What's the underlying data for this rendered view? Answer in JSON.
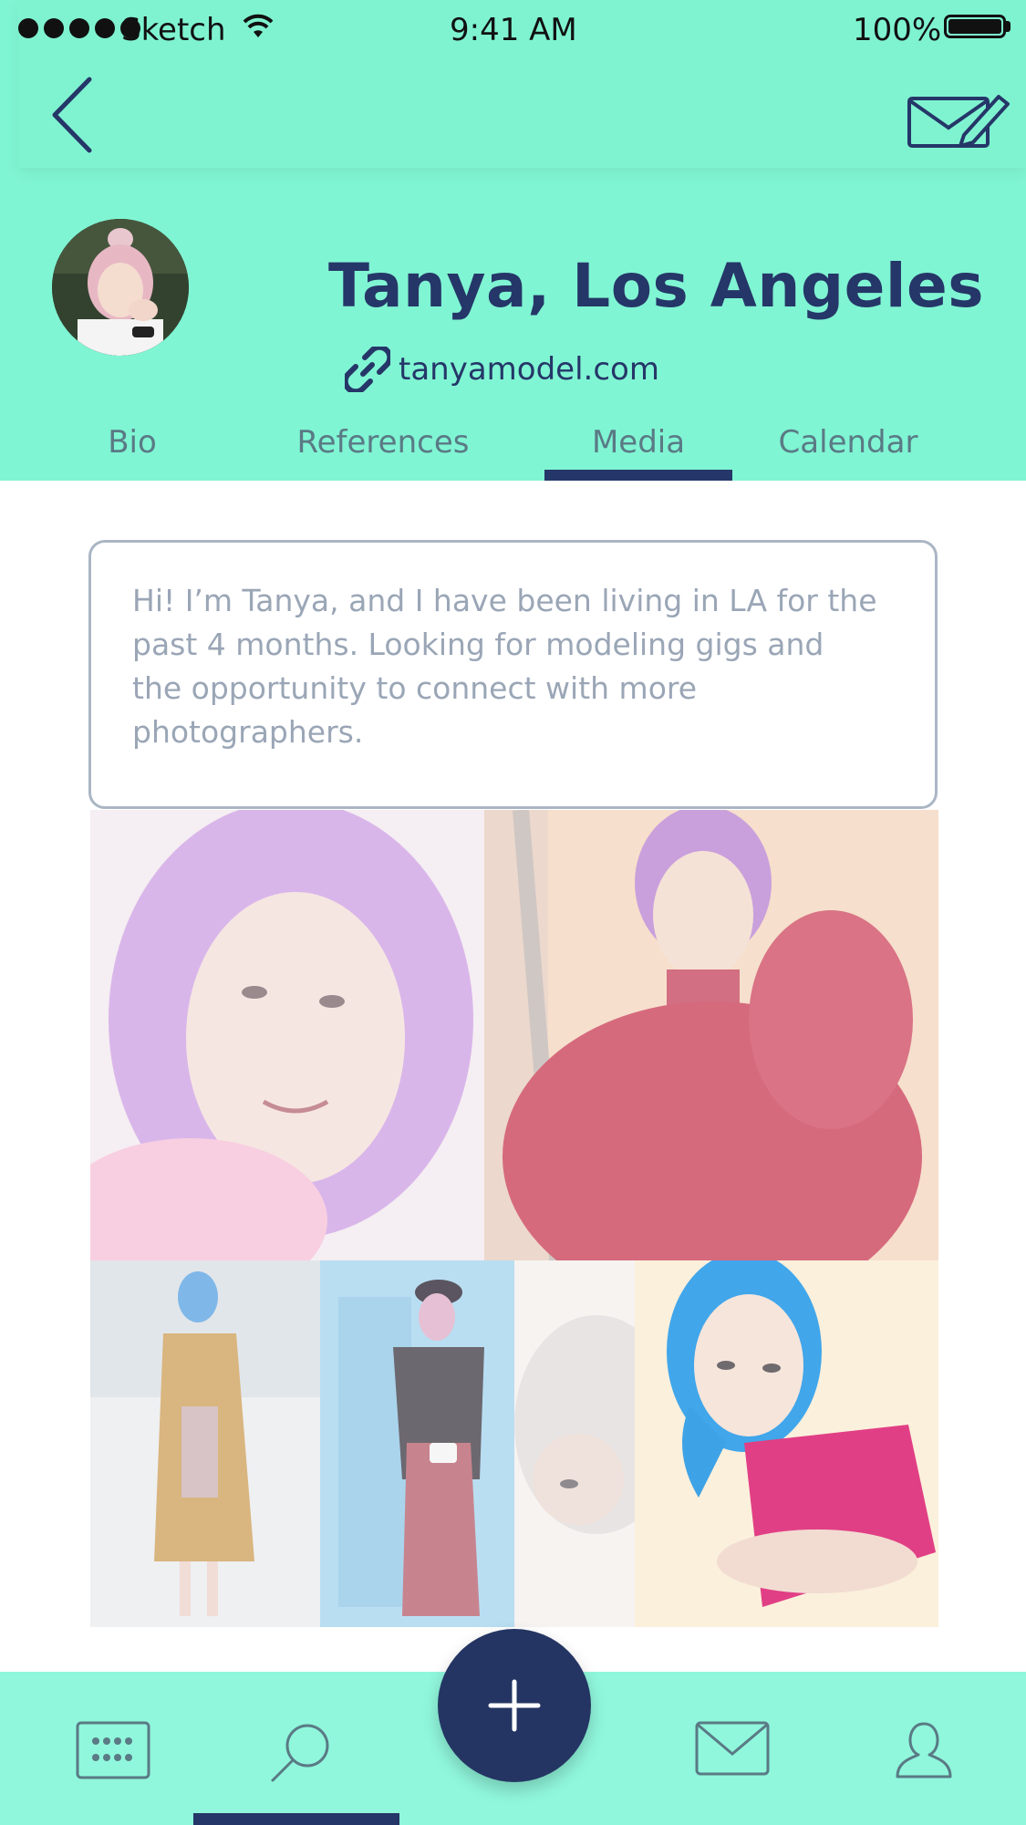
{
  "status_bar": {
    "carrier": "Sketch",
    "time": "9:41 AM",
    "battery": "100%"
  },
  "nav": {
    "back_icon": "chevron-left-icon",
    "compose_icon": "mail-compose-icon"
  },
  "profile": {
    "name": "Tanya, Los Angeles",
    "link": "tanyamodel.com",
    "link_icon": "link-icon"
  },
  "tabs": [
    {
      "label": "Bio"
    },
    {
      "label": "References"
    },
    {
      "label": "Media",
      "selected": true
    },
    {
      "label": "Calendar"
    }
  ],
  "bio": {
    "text": "Hi! I’m Tanya, and I have been living in LA for the past 4 months. Looking for modeling gigs and the opportunity to connect with more photographers."
  },
  "bottom_nav": {
    "items": [
      {
        "icon": "calendar-icon"
      },
      {
        "icon": "search-icon",
        "selected": true
      },
      {
        "icon": "plus-icon"
      },
      {
        "icon": "mail-icon"
      },
      {
        "icon": "profile-icon"
      }
    ]
  },
  "colors": {
    "header_bg": "#80f5d3",
    "accent": "#253668",
    "tab_text": "#5a7a85",
    "bio_text": "#9aa6b6"
  }
}
